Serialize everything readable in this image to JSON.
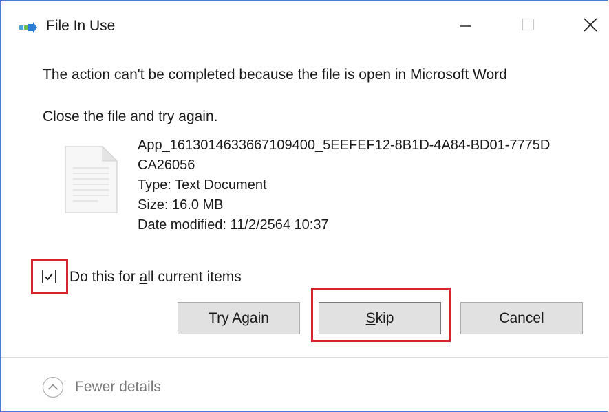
{
  "window": {
    "title": "File In Use"
  },
  "message": {
    "main": "The action can't be completed because the file is open in Microsoft Word",
    "sub": "Close the file and try again."
  },
  "file": {
    "name_line1": "App_1613014633667109400_5EEFEF12-8B1D-4A84-BD01-7775D",
    "name_line2": "CA26056",
    "type": "Type: Text Document",
    "size": "Size: 16.0 MB",
    "modified": "Date modified: 11/2/2564 10:37"
  },
  "checkbox": {
    "checked": true,
    "label_pre": "Do this for ",
    "label_ul": "a",
    "label_post": "ll current items"
  },
  "buttons": {
    "try_again": "Try Again",
    "skip_ul": "S",
    "skip_rest": "kip",
    "cancel": "Cancel"
  },
  "details": {
    "label": "Fewer details"
  },
  "colors": {
    "highlight": "#d5232f",
    "window_border": "#4b7bd1",
    "button_bg": "#e1e1e1"
  },
  "icons": {
    "app": "file-move-icon",
    "file": "text-document-icon",
    "details": "chevron-up-circle-icon"
  }
}
